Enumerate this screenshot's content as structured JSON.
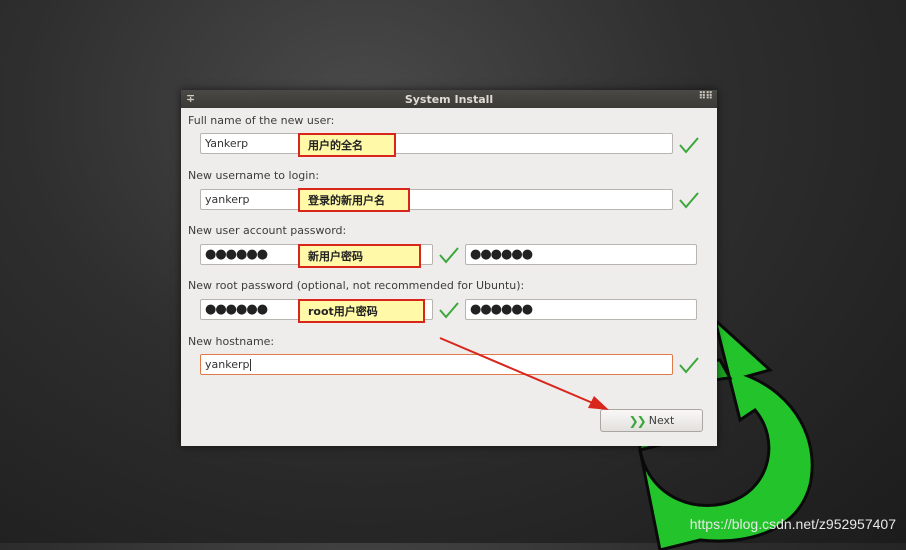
{
  "window": {
    "title": "System Install",
    "menu_icon": "pin-icon",
    "grip_icon": "grip-icon"
  },
  "form": {
    "fullname_label": "Full name of the new user:",
    "fullname_value": "Yankerp",
    "username_label": "New username to login:",
    "username_value": "yankerp",
    "password_label": "New user account password:",
    "password_value": "●●●●●●",
    "password_confirm_value": "●●●●●●",
    "root_label": "New root password (optional, not recommended for Ubuntu):",
    "root_value": "●●●●●●",
    "root_confirm_value": "●●●●●●",
    "hostname_label": "New hostname:",
    "hostname_value": "yankerp"
  },
  "annotations": {
    "fullname": "用户的全名",
    "username": "登录的新用户名",
    "password": "新用户密码",
    "root": "root用户密码"
  },
  "buttons": {
    "next_label": "Next"
  },
  "watermark": "https://blog.csdn.net/z952957407",
  "colors": {
    "check": "#3aa83a",
    "annotation_border": "#d9261c",
    "annotation_fill": "#fff9a8",
    "focus_border": "#e07a4b"
  }
}
